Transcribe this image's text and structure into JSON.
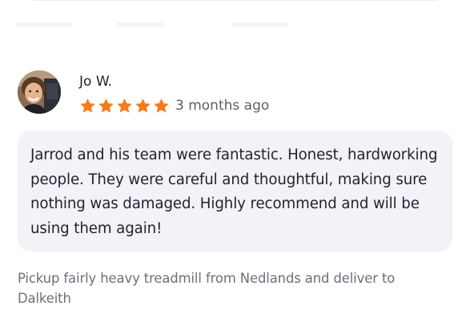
{
  "review": {
    "reviewer_name": "Jo W.",
    "rating": 5,
    "rating_max": 5,
    "time_ago": "3 months ago",
    "text": "Jarrod and his team were fantastic. Honest, hardworking people. They were careful and thoughtful, making sure nothing was damaged. Highly recommend and will be using them again!",
    "avatar_icon": "reviewer-photo",
    "star_icon": "star-icon"
  },
  "job": {
    "description": "Pickup fairly heavy treadmill from Nedlands and deliver to Dalkeith"
  },
  "colors": {
    "star": "#f47b20",
    "bubble": "#f2f2f7",
    "text_primary": "#1f2230",
    "text_secondary": "#6c6f78"
  }
}
